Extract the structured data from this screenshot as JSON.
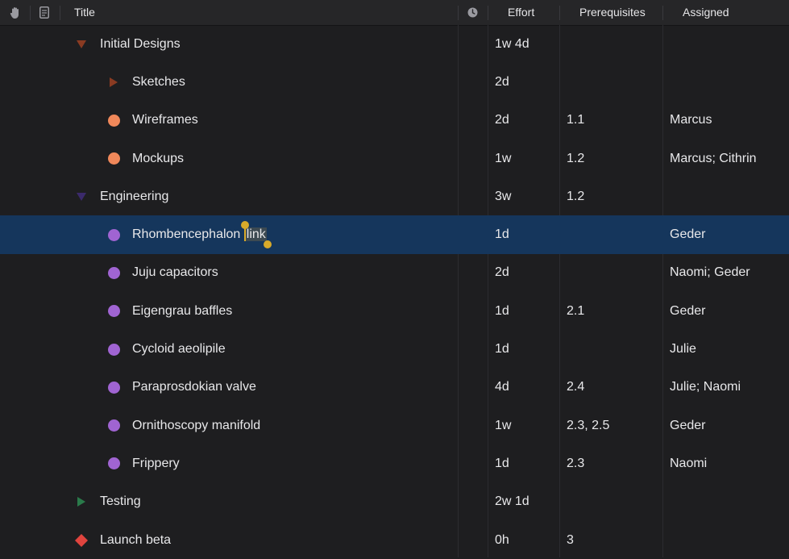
{
  "header": {
    "title": "Title",
    "effort": "Effort",
    "prerequisites": "Prerequisites",
    "assigned": "Assigned",
    "icons": [
      "hand-icon",
      "note-icon",
      "clock-icon"
    ]
  },
  "colors": {
    "background": "#1e1e20",
    "selected_row": "#15365c",
    "design_group": "#8a3b22",
    "design_status": "#f0885a",
    "engineering_group": "#3b2a6b",
    "engineering_status": "#a064d2",
    "testing_group": "#2a7a4a",
    "milestone": "#e0443e",
    "text_handles": "#d8aa2a"
  },
  "rows": [
    {
      "title": "Initial Designs",
      "effort": "1w 4d",
      "prereq": "",
      "assigned": ""
    },
    {
      "title": "Sketches",
      "effort": "2d",
      "prereq": "",
      "assigned": ""
    },
    {
      "title": "Wireframes",
      "effort": "2d",
      "prereq": "1.1",
      "assigned": "Marcus"
    },
    {
      "title": "Mockups",
      "effort": "1w",
      "prereq": "1.2",
      "assigned": "Marcus; Cithrin"
    },
    {
      "title": "Engineering",
      "effort": "3w",
      "prereq": "1.2",
      "assigned": ""
    },
    {
      "title": "Rhombencephalon",
      "title_selected": "link",
      "effort": "1d",
      "prereq": "",
      "assigned": "Geder"
    },
    {
      "title": "Juju capacitors",
      "effort": "2d",
      "prereq": "",
      "assigned": "Naomi; Geder"
    },
    {
      "title": "Eigengrau baffles",
      "effort": "1d",
      "prereq": "2.1",
      "assigned": "Geder"
    },
    {
      "title": "Cycloid aeolipile",
      "effort": "1d",
      "prereq": "",
      "assigned": "Julie"
    },
    {
      "title": "Paraprosdokian valve",
      "effort": "4d",
      "prereq": "2.4",
      "assigned": "Julie; Naomi"
    },
    {
      "title": "Ornithoscopy manifold",
      "effort": "1w",
      "prereq": "2.3, 2.5",
      "assigned": "Geder"
    },
    {
      "title": "Frippery",
      "effort": "1d",
      "prereq": "2.3",
      "assigned": "Naomi"
    },
    {
      "title": "Testing",
      "effort": "2w 1d",
      "prereq": "",
      "assigned": ""
    },
    {
      "title": "Launch beta",
      "effort": "0h",
      "prereq": "3",
      "assigned": ""
    }
  ]
}
